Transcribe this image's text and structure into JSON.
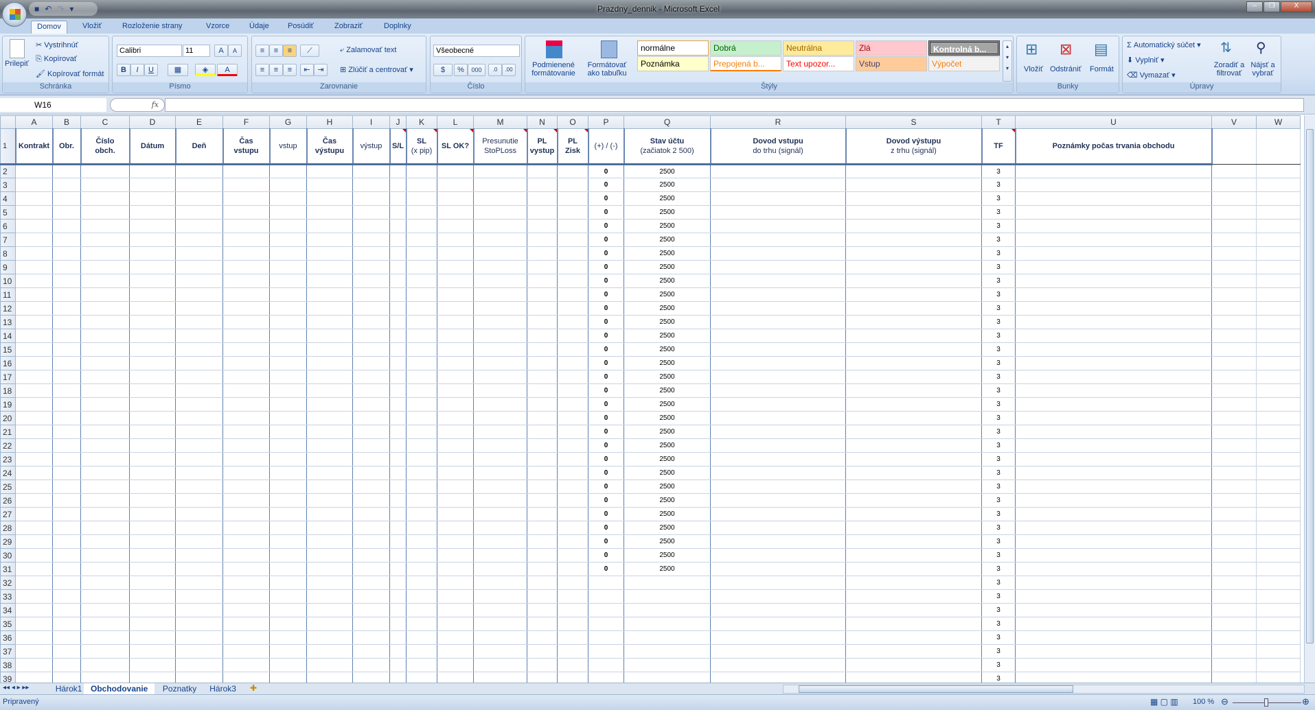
{
  "window": {
    "title": "Prazdny_dennik - Microsoft Excel"
  },
  "ribbon_tabs": [
    "Domov",
    "Vložiť",
    "Rozloženie strany",
    "Vzorce",
    "Údaje",
    "Posúdiť",
    "Zobraziť",
    "Doplnky"
  ],
  "clipboard": {
    "paste": "Prilepiť",
    "cut": "Vystrihnúť",
    "copy": "Kopírovať",
    "format_painter": "Kopírovať formát",
    "group": "Schránka"
  },
  "font": {
    "name": "Calibri",
    "size": "11",
    "group": "Písmo",
    "bold": "B",
    "italic": "I",
    "underline": "U"
  },
  "alignment": {
    "wrap": "Zalamovať text",
    "merge": "Zlúčiť a centrovať",
    "group": "Zarovnanie"
  },
  "number": {
    "format": "Všeobecné",
    "percent": "%",
    "thousands": "000",
    "group": "Číslo"
  },
  "styles": {
    "conditional": "Podmienené formátovanie",
    "table": "Formátovať ako tabuľku",
    "group": "Štýly",
    "items": [
      {
        "label": "normálne",
        "bg": "#ffffff",
        "fg": "#000000"
      },
      {
        "label": "Dobrá",
        "bg": "#c6efce",
        "fg": "#006100"
      },
      {
        "label": "Neutrálna",
        "bg": "#ffeb9c",
        "fg": "#9c6500"
      },
      {
        "label": "Zlá",
        "bg": "#ffc7ce",
        "fg": "#9c0006"
      },
      {
        "label": "Kontrolná b...",
        "bg": "#a5a5a5",
        "fg": "#ffffff"
      },
      {
        "label": "Poznámka",
        "bg": "#ffffcc",
        "fg": "#000000"
      },
      {
        "label": "Prepojená b...",
        "bg": "#ffffff",
        "fg": "#fa7d00"
      },
      {
        "label": "Text upozor...",
        "bg": "#ffffff",
        "fg": "#ff0000"
      },
      {
        "label": "Vstup",
        "bg": "#ffcc99",
        "fg": "#3f3f76"
      },
      {
        "label": "Výpočet",
        "bg": "#f2f2f2",
        "fg": "#fa7d00"
      }
    ]
  },
  "cells": {
    "insert": "Vložiť",
    "delete": "Odstrániť",
    "format": "Formát",
    "group": "Bunky"
  },
  "editing": {
    "autosum": "Automatický súčet",
    "fill": "Vyplniť",
    "clear": "Vymazať",
    "sort": "Zoradiť a filtrovať",
    "find": "Nájsť a vybrať",
    "group": "Úpravy"
  },
  "formula_bar": {
    "name_box": "W16",
    "fx": "fx",
    "formula": ""
  },
  "columns": [
    "A",
    "B",
    "C",
    "D",
    "E",
    "F",
    "G",
    "H",
    "I",
    "J",
    "K",
    "L",
    "M",
    "N",
    "O",
    "P",
    "Q",
    "R",
    "S",
    "T",
    "U",
    "V",
    "W"
  ],
  "header_row": [
    {
      "l1": "Kontrakt",
      "bold": true
    },
    {
      "l1": "Obr.",
      "bold": true
    },
    {
      "l1": "Číslo",
      "l2": "obch.",
      "bold": true
    },
    {
      "l1": "Dátum",
      "bold": true
    },
    {
      "l1": "Deň",
      "bold": true
    },
    {
      "l1": "Čas",
      "l2": "vstupu",
      "bold": true
    },
    {
      "l1": "vstup"
    },
    {
      "l1": "Čas",
      "l2": "výstupu",
      "bold": true
    },
    {
      "l1": "výstup"
    },
    {
      "l1": "S/L",
      "bold": true,
      "note": true
    },
    {
      "l1": "SL",
      "l2": "(x pip)",
      "bold": true,
      "note": true
    },
    {
      "l1": "SL OK?",
      "bold": true,
      "note": true
    },
    {
      "l1": "Presunutie",
      "l2": "StoPLoss",
      "note": true
    },
    {
      "l1": "PL",
      "l2": "vystup",
      "bold": true,
      "note": true
    },
    {
      "l1": "PL",
      "l2": "Zisk",
      "bold": true,
      "note": true
    },
    {
      "l1": "(+) / (-)"
    },
    {
      "l1": "Stav účtu",
      "l2": "(začiatok 2 500)",
      "bold": true
    },
    {
      "l1": "Dovod vstupu",
      "l2": "do trhu (signál)",
      "bold": true
    },
    {
      "l1": "Dovod výstupu",
      "l2": "z trhu (signál)",
      "bold": true
    },
    {
      "l1": "TF",
      "bold": true,
      "note": true
    },
    {
      "l1": "Poznámky počas trvania obchodu",
      "bold": true
    },
    {
      "l1": ""
    },
    {
      "l1": ""
    }
  ],
  "rows": [
    {
      "n": "2",
      "p": "0",
      "q": "2500",
      "t": "3"
    },
    {
      "n": "3",
      "p": "0",
      "q": "2500",
      "t": "3"
    },
    {
      "n": "4",
      "p": "0",
      "q": "2500",
      "t": "3"
    },
    {
      "n": "5",
      "p": "0",
      "q": "2500",
      "t": "3"
    },
    {
      "n": "6",
      "p": "0",
      "q": "2500",
      "t": "3"
    },
    {
      "n": "7",
      "p": "0",
      "q": "2500",
      "t": "3"
    },
    {
      "n": "8",
      "p": "0",
      "q": "2500",
      "t": "3"
    },
    {
      "n": "9",
      "p": "0",
      "q": "2500",
      "t": "3"
    },
    {
      "n": "10",
      "p": "0",
      "q": "2500",
      "t": "3"
    },
    {
      "n": "11",
      "p": "0",
      "q": "2500",
      "t": "3"
    },
    {
      "n": "12",
      "p": "0",
      "q": "2500",
      "t": "3"
    },
    {
      "n": "13",
      "p": "0",
      "q": "2500",
      "t": "3"
    },
    {
      "n": "14",
      "p": "0",
      "q": "2500",
      "t": "3"
    },
    {
      "n": "15",
      "p": "0",
      "q": "2500",
      "t": "3"
    },
    {
      "n": "16",
      "p": "0",
      "q": "2500",
      "t": "3"
    },
    {
      "n": "17",
      "p": "0",
      "q": "2500",
      "t": "3"
    },
    {
      "n": "18",
      "p": "0",
      "q": "2500",
      "t": "3"
    },
    {
      "n": "19",
      "p": "0",
      "q": "2500",
      "t": "3"
    },
    {
      "n": "20",
      "p": "0",
      "q": "2500",
      "t": "3"
    },
    {
      "n": "21",
      "p": "0",
      "q": "2500",
      "t": "3"
    },
    {
      "n": "22",
      "p": "0",
      "q": "2500",
      "t": "3"
    },
    {
      "n": "23",
      "p": "0",
      "q": "2500",
      "t": "3"
    },
    {
      "n": "24",
      "p": "0",
      "q": "2500",
      "t": "3"
    },
    {
      "n": "25",
      "p": "0",
      "q": "2500",
      "t": "3"
    },
    {
      "n": "26",
      "p": "0",
      "q": "2500",
      "t": "3"
    },
    {
      "n": "27",
      "p": "0",
      "q": "2500",
      "t": "3"
    },
    {
      "n": "28",
      "p": "0",
      "q": "2500",
      "t": "3"
    },
    {
      "n": "29",
      "p": "0",
      "q": "2500",
      "t": "3"
    },
    {
      "n": "30",
      "p": "0",
      "q": "2500",
      "t": "3"
    },
    {
      "n": "31",
      "p": "0",
      "q": "2500",
      "t": "3"
    },
    {
      "n": "32",
      "p": "",
      "q": "",
      "t": "3"
    },
    {
      "n": "33",
      "p": "",
      "q": "",
      "t": "3"
    },
    {
      "n": "34",
      "p": "",
      "q": "",
      "t": "3"
    },
    {
      "n": "35",
      "p": "",
      "q": "",
      "t": "3"
    },
    {
      "n": "36",
      "p": "",
      "q": "",
      "t": "3"
    },
    {
      "n": "37",
      "p": "",
      "q": "",
      "t": "3"
    },
    {
      "n": "38",
      "p": "",
      "q": "",
      "t": "3"
    },
    {
      "n": "39",
      "p": "",
      "q": "",
      "t": "3"
    }
  ],
  "sheet_tabs": [
    "Hárok1",
    "Obchodovanie",
    "Poznatky",
    "Hárok3"
  ],
  "active_sheet": "Obchodovanie",
  "status": {
    "text": "Pripravený",
    "zoom": "100 %"
  }
}
